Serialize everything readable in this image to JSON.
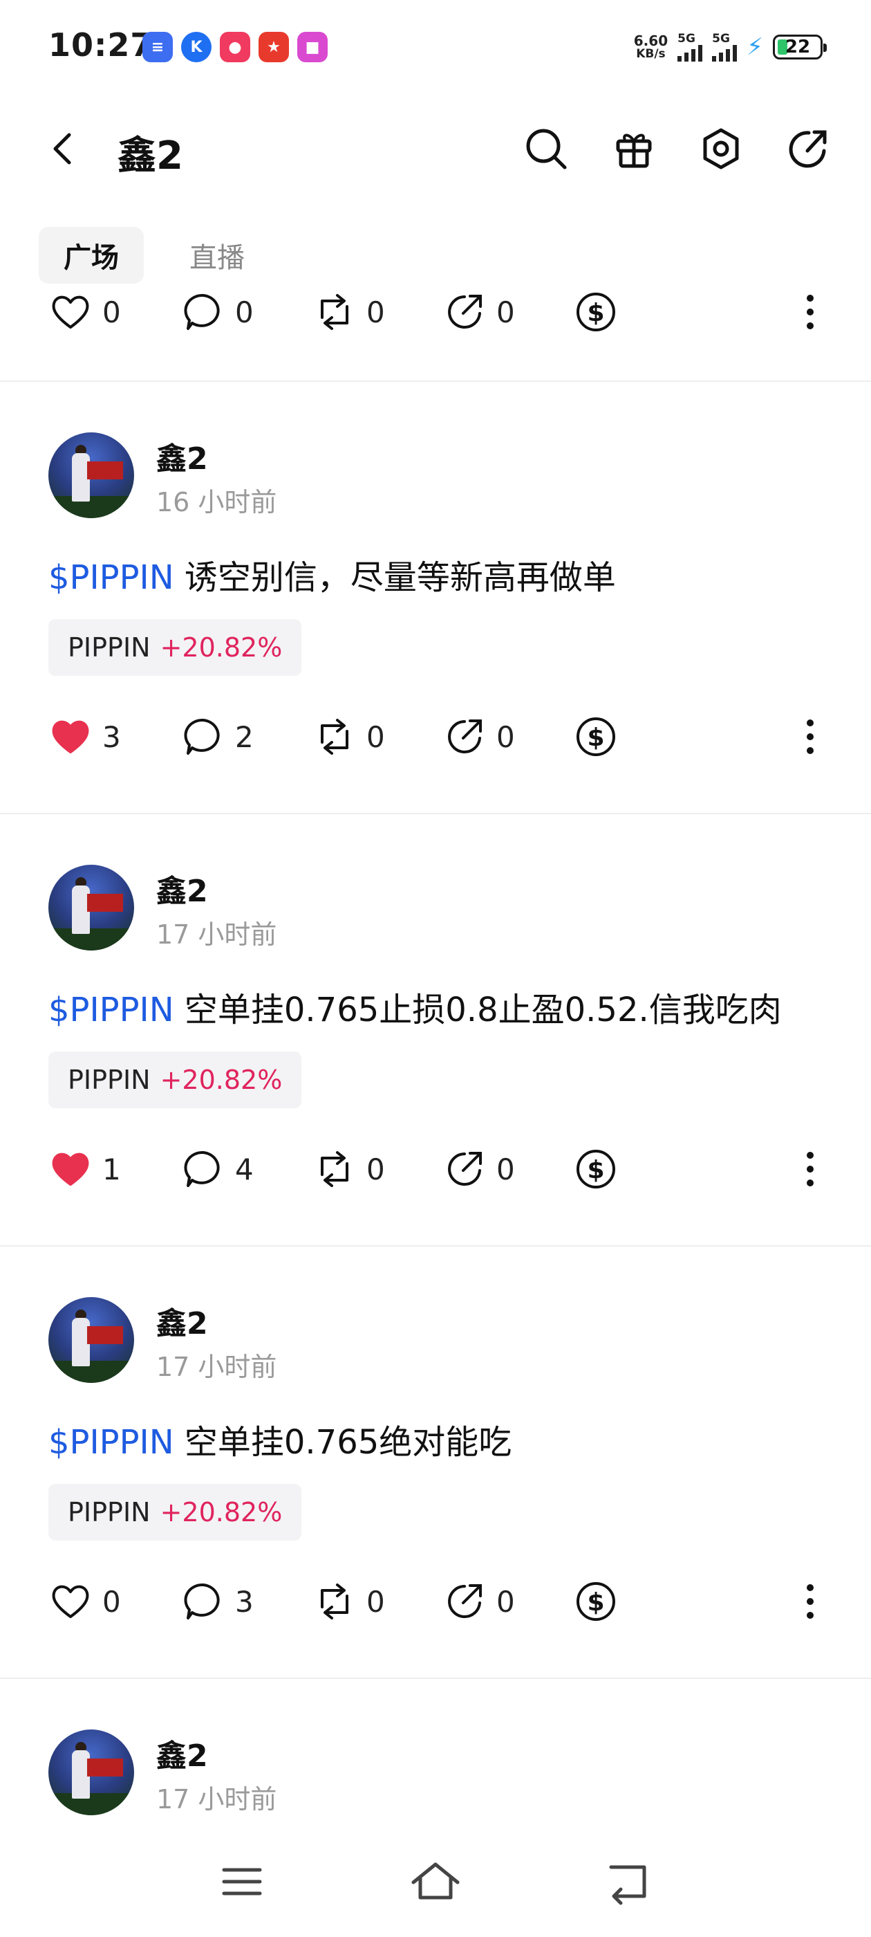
{
  "status_bar": {
    "time": "10:27",
    "notification_icons": [
      "messages-app-icon",
      "k-app-icon",
      "video-app-icon",
      "shopping-app-icon",
      "tieba-app-icon"
    ],
    "net_speed_value": "6.60",
    "net_speed_unit": "KB/s",
    "sim1_label": "5G",
    "sim2_label": "5G",
    "battery_level": "22"
  },
  "header": {
    "title": "鑫2",
    "icons": [
      "back-icon",
      "search-icon",
      "gift-icon",
      "settings-icon",
      "share-icon"
    ]
  },
  "tabs": [
    {
      "label": "广场",
      "active": true
    },
    {
      "label": "直播",
      "active": false
    }
  ],
  "partial_post": {
    "likes": "0",
    "comments": "0",
    "reposts": "0",
    "shares": "0"
  },
  "posts": [
    {
      "username": "鑫2",
      "time": "16 小时前",
      "cashtag": "$PIPPIN",
      "text": " 诱空别信，尽量等新高再做单",
      "chip_symbol": "PIPPIN",
      "chip_change": "+20.82%",
      "liked": true,
      "likes": "3",
      "comments": "2",
      "reposts": "0",
      "shares": "0"
    },
    {
      "username": "鑫2",
      "time": "17 小时前",
      "cashtag": "$PIPPIN",
      "text": " 空单挂0.765止损0.8止盈0.52.信我吃肉",
      "chip_symbol": "PIPPIN",
      "chip_change": "+20.82%",
      "liked": true,
      "likes": "1",
      "comments": "4",
      "reposts": "0",
      "shares": "0"
    },
    {
      "username": "鑫2",
      "time": "17 小时前",
      "cashtag": "$PIPPIN",
      "text": " 空单挂0.765绝对能吃",
      "chip_symbol": "PIPPIN",
      "chip_change": "+20.82%",
      "liked": false,
      "likes": "0",
      "comments": "3",
      "reposts": "0",
      "shares": "0"
    },
    {
      "username": "鑫2",
      "time": "17 小时前"
    }
  ],
  "colors": {
    "like_red": "#e8314f",
    "cashtag_blue": "#1e5be0",
    "change_pink": "#e0245e"
  },
  "nav": {
    "icons": [
      "menu-icon",
      "home-icon",
      "back-nav-icon"
    ]
  }
}
